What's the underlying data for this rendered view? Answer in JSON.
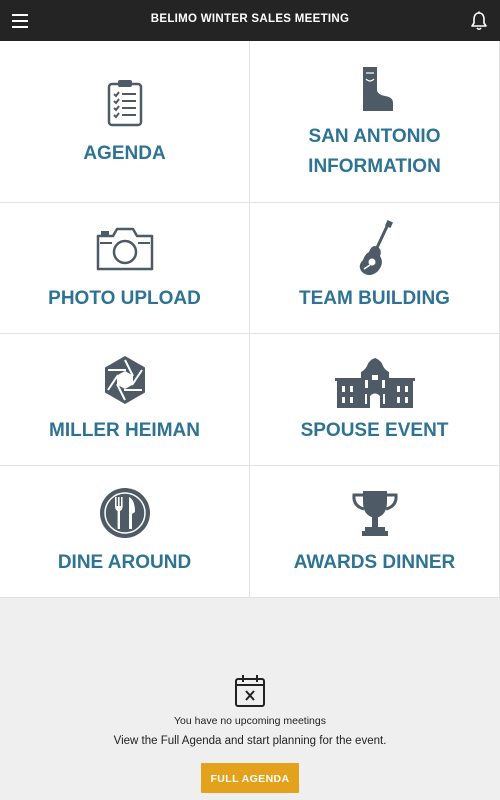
{
  "header": {
    "title": "BELIMO WINTER SALES MEETING",
    "menu_icon": "hamburger-menu-icon",
    "bell_icon": "bell-icon"
  },
  "tiles": [
    {
      "label_lines": [
        "AGENDA"
      ],
      "icon": "clipboard-checklist-icon"
    },
    {
      "label_lines": [
        "SAN ANTONIO",
        "INFORMATION"
      ],
      "icon": "cowboy-boot-icon"
    },
    {
      "label_lines": [
        "PHOTO UPLOAD"
      ],
      "icon": "camera-icon"
    },
    {
      "label_lines": [
        "TEAM BUILDING"
      ],
      "icon": "guitar-icon"
    },
    {
      "label_lines": [
        "MILLER HEIMAN"
      ],
      "icon": "aperture-icon"
    },
    {
      "label_lines": [
        "SPOUSE EVENT"
      ],
      "icon": "alamo-building-icon"
    },
    {
      "label_lines": [
        "DINE AROUND"
      ],
      "icon": "fork-knife-icon"
    },
    {
      "label_lines": [
        "AWARDS DINNER"
      ],
      "icon": "trophy-icon"
    }
  ],
  "empty_state": {
    "icon": "calendar-x-icon",
    "message": "You have no upcoming meetings",
    "sub_message": "View the Full Agenda and start planning for the event.",
    "button_label": "FULL AGENDA"
  },
  "colors": {
    "header_bg": "#242424",
    "label_blue": "#2f7394",
    "icon_gray": "#4e5b66",
    "button_orange": "#e4a21c",
    "background": "#efefef"
  }
}
